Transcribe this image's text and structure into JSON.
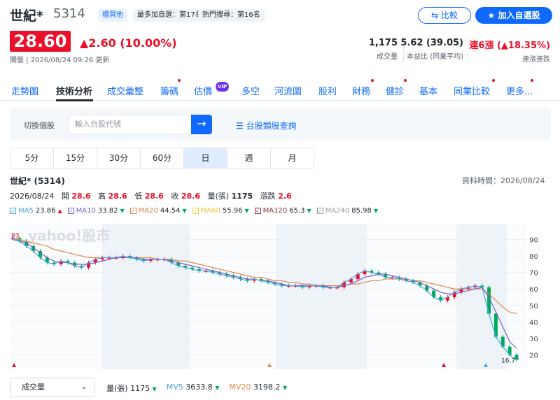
{
  "header": {
    "name": "世紀*",
    "code": "5314",
    "tags": [
      "櫃買他",
      "最多加自選：第17名",
      "熱門搜尋：第16名"
    ],
    "price": "28.60",
    "change": "▲2.60 (10.00%)",
    "status_time": "開盤 | 2026/08/24 09:26 更新",
    "compare_btn": "比較",
    "add_watch_btn": "加入自選股",
    "stats": [
      {
        "value": "1,175",
        "label": "成交量"
      },
      {
        "value": "5.62 (39.05)",
        "label": "本益比 (同業平均)"
      },
      {
        "value": "連6漲 (▲18.35%)",
        "label": "連漲連跌"
      }
    ]
  },
  "nav": {
    "tabs": [
      "走勢圖",
      "技術分析",
      "成交彙整",
      "籌碼",
      "估價",
      "多空",
      "河流圖",
      "股利",
      "財務",
      "健診",
      "基本",
      "同業比較",
      "更多..."
    ],
    "vip_badge": "VIP"
  },
  "search": {
    "label": "切換個股",
    "placeholder": "輸入台股代號",
    "category_link": "台股類股查詢"
  },
  "periods": [
    "5分",
    "15分",
    "30分",
    "60分",
    "日",
    "週",
    "月"
  ],
  "chart_header": {
    "title": "世紀* (5314)",
    "data_time": "資料時間：2026/08/24",
    "date": "2026/08/24",
    "open_label": "開",
    "open": "28.6",
    "high_label": "高",
    "high": "28.6",
    "low_label": "低",
    "low": "28.6",
    "close_label": "收",
    "close": "28.6",
    "vol_label": "量(張)",
    "vol": "1175",
    "chg_label": "漲跌",
    "chg": "2.6"
  },
  "legend": [
    {
      "name": "MA5",
      "value": "23.86",
      "dir": "up",
      "color": "#4aa3e6"
    },
    {
      "name": "MA10",
      "value": "33.82",
      "dir": "down",
      "color": "#7a5fc7"
    },
    {
      "name": "MA20",
      "value": "44.54",
      "dir": "down",
      "color": "#e0894a"
    },
    {
      "name": "MA60",
      "value": "55.96",
      "dir": "down",
      "color": "#f4c542"
    },
    {
      "name": "MA120",
      "value": "65.3",
      "dir": "down",
      "color": "#8b2e3a"
    },
    {
      "name": "MA240",
      "value": "85.98",
      "dir": "down",
      "color": "#9a9a9a"
    }
  ],
  "watermark": "yahoo!股市",
  "chart_data": {
    "type": "line",
    "yticks": [
      "90",
      "80",
      "70",
      "60",
      "50",
      "40",
      "30",
      "20"
    ],
    "ylim": [
      13,
      97
    ],
    "first_label": "93",
    "last_label": "16.7",
    "close": [
      91,
      89,
      86,
      83,
      79,
      76,
      75,
      77,
      76,
      74,
      73,
      76,
      78,
      79,
      79,
      79,
      80,
      79,
      78,
      77,
      78,
      78,
      78,
      76,
      74,
      73,
      72,
      71,
      71,
      70,
      69,
      68,
      67,
      66,
      65,
      66,
      65,
      64,
      63,
      62,
      62,
      62,
      61,
      62,
      62,
      61,
      61,
      61,
      64,
      66,
      69,
      71,
      70,
      69,
      67,
      67,
      66,
      65,
      64,
      62,
      59,
      55,
      53,
      55,
      58,
      60,
      61,
      62,
      61,
      45,
      31,
      25,
      20,
      17
    ],
    "ma5": [
      90,
      89,
      88,
      85,
      82,
      79,
      77,
      76,
      76,
      75,
      75,
      75,
      76,
      77,
      78,
      79,
      79,
      79,
      79,
      78,
      78,
      78,
      78,
      77,
      76,
      75,
      74,
      73,
      72,
      71,
      70,
      69,
      68,
      67,
      66,
      66,
      65,
      65,
      64,
      63,
      62,
      62,
      62,
      62,
      62,
      62,
      61,
      61,
      62,
      63,
      65,
      67,
      68,
      69,
      69,
      68,
      67,
      66,
      65,
      64,
      62,
      60,
      58,
      57,
      57,
      58,
      59,
      60,
      61,
      55,
      46,
      37,
      28,
      24
    ],
    "ma20": [
      91,
      90,
      89,
      88,
      87,
      86,
      84,
      83,
      82,
      81,
      80,
      79,
      79,
      79,
      79,
      79,
      79,
      79,
      79,
      79,
      79,
      78,
      78,
      78,
      77,
      77,
      76,
      75,
      74,
      73,
      72,
      71,
      70,
      69,
      68,
      67,
      67,
      66,
      65,
      65,
      64,
      64,
      63,
      63,
      62,
      62,
      62,
      62,
      62,
      63,
      63,
      64,
      65,
      65,
      66,
      66,
      66,
      66,
      65,
      65,
      64,
      63,
      62,
      61,
      60,
      60,
      60,
      60,
      60,
      57,
      53,
      49,
      46,
      45
    ],
    "volume_label": "量(張)",
    "volume": "1175",
    "mv5_label": "MV5",
    "mv5": "3633.8",
    "mv20_label": "MV20",
    "mv20": "3198.2"
  },
  "footer": {
    "select_value": "成交量"
  }
}
